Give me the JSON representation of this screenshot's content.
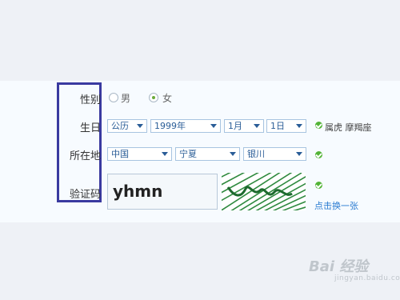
{
  "form": {
    "gender": {
      "label": "性别",
      "options": [
        "男",
        "女"
      ],
      "selected": "女"
    },
    "birthday": {
      "label": "生日",
      "calendar": "公历",
      "year": "1999年",
      "month": "1月",
      "day": "1日",
      "zodiac": "属虎 摩羯座"
    },
    "location": {
      "label": "所在地",
      "country": "中国",
      "province": "宁夏",
      "city": "银川"
    },
    "captcha": {
      "label": "验证码",
      "value": "yhmn",
      "refresh_link": "点击换一张"
    }
  },
  "colors": {
    "label_box_border": "#3a3aa0",
    "check_green": "#52b336",
    "select_text": "#2a5d97",
    "link": "#2a7bd1"
  },
  "watermark": {
    "logo_text": "Bai 经验",
    "site": "jingyan.baidu.com"
  }
}
